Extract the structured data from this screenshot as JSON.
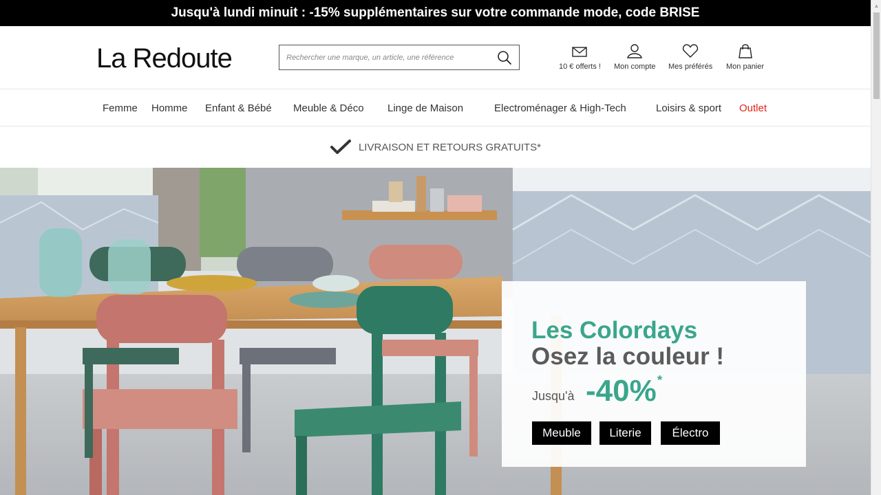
{
  "promo_banner": {
    "text": "Jusqu'à lundi minuit : -15% supplémentaires sur votre commande mode, code BRISE"
  },
  "header": {
    "logo": "La Redoute",
    "search": {
      "placeholder": "Rechercher une marque, un article, une référence",
      "value": ""
    },
    "icons": [
      {
        "name": "mail-icon",
        "label": "10 € offerts !"
      },
      {
        "name": "user-icon",
        "label": "Mon compte"
      },
      {
        "name": "heart-icon",
        "label": "Mes préférés"
      },
      {
        "name": "bag-icon",
        "label": "Mon panier"
      }
    ]
  },
  "nav": {
    "items": [
      {
        "label": "Femme"
      },
      {
        "label": "Homme"
      },
      {
        "label": "Enfant & Bébé"
      },
      {
        "label": "Meuble & Déco"
      },
      {
        "label": "Linge de Maison"
      },
      {
        "label": "Electroménager & High-Tech"
      },
      {
        "label": "Loisirs & sport"
      },
      {
        "label": "Outlet"
      }
    ]
  },
  "delivery": {
    "text": "LIVRAISON ET RETOURS GRATUITS*"
  },
  "hero": {
    "title": "Les Colordays",
    "subtitle": "Osez la couleur !",
    "upto": "Jusqu'à",
    "discount": "-40%",
    "asterisk": "*",
    "buttons": [
      {
        "label": "Meuble"
      },
      {
        "label": "Literie"
      },
      {
        "label": "Électro"
      }
    ]
  },
  "colors": {
    "accent_green": "#3aa68c",
    "outlet_red": "#e2231a",
    "banner_black": "#000000"
  }
}
